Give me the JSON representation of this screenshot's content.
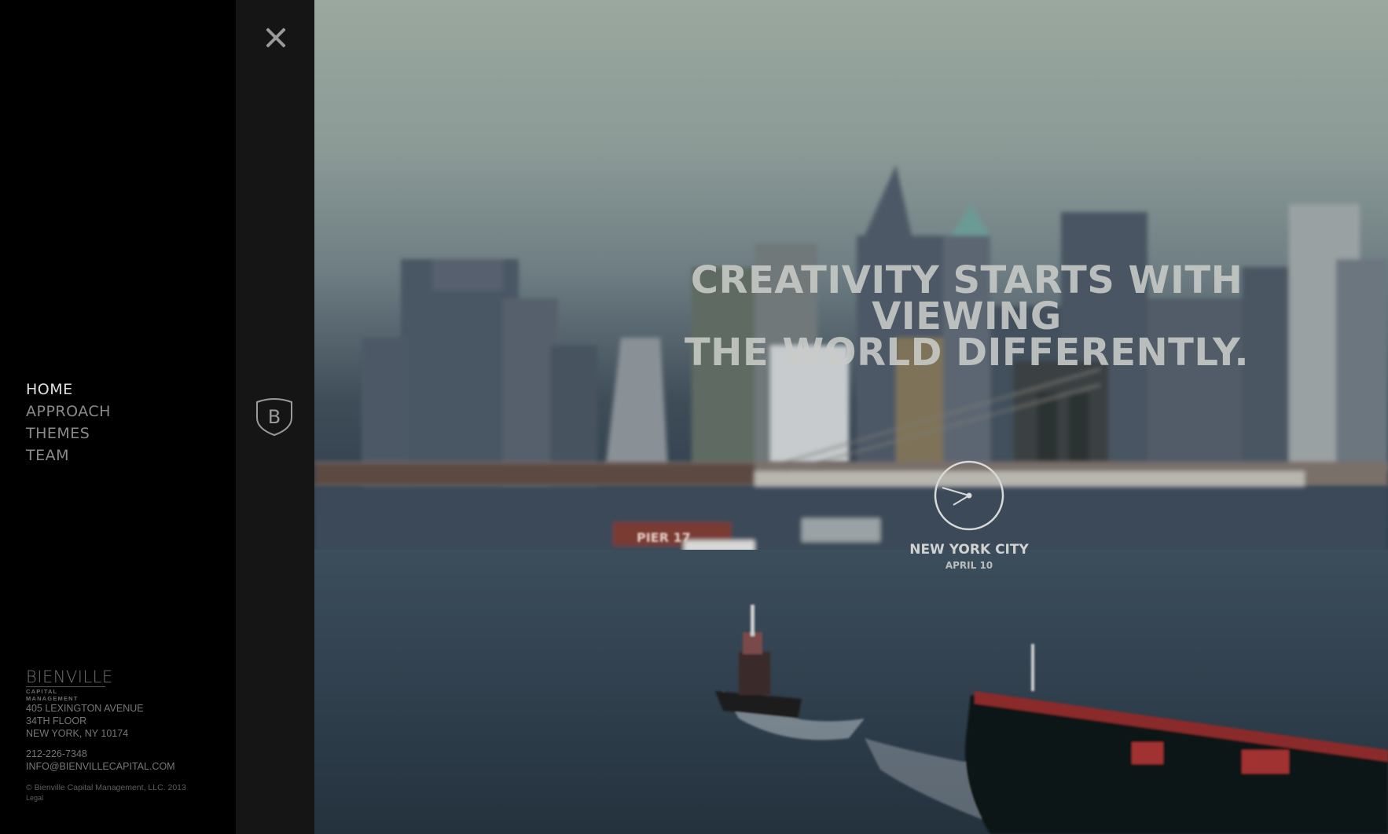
{
  "nav": {
    "items": [
      {
        "label": "HOME",
        "active": true
      },
      {
        "label": "APPROACH",
        "active": false
      },
      {
        "label": "THEMES",
        "active": false
      },
      {
        "label": "TEAM",
        "active": false
      }
    ]
  },
  "brand": {
    "name": "BIENVILLE",
    "sub": "CAPITAL MANAGEMENT"
  },
  "address": {
    "line1": "405 LEXINGTON AVENUE",
    "line2": "34TH FLOOR",
    "line3": "NEW YORK, NY 10174"
  },
  "contact": {
    "phone": "212-226-7348",
    "email": "INFO@BIENVILLECAPITAL.COM"
  },
  "footer": {
    "copyright": "© Bienville Capital Management, LLC. 2013",
    "legal": "Legal"
  },
  "strip": {
    "close_icon": "close-icon",
    "logo_icon": "shield-b-logo-icon",
    "logo_letter": "B"
  },
  "hero": {
    "headline_line1": "CREATIVITY STARTS WITH VIEWING",
    "headline_line2": "THE WORLD DIFFERENTLY.",
    "clock_icon": "clock-icon",
    "city": "NEW YORK CITY",
    "date": "APRIL 10",
    "sign_text": "PIER 17"
  },
  "colors": {
    "sidebar": "#000000",
    "strip": "#151515",
    "nav_active": "#e0e0e0",
    "nav": "#8a8a8a"
  }
}
